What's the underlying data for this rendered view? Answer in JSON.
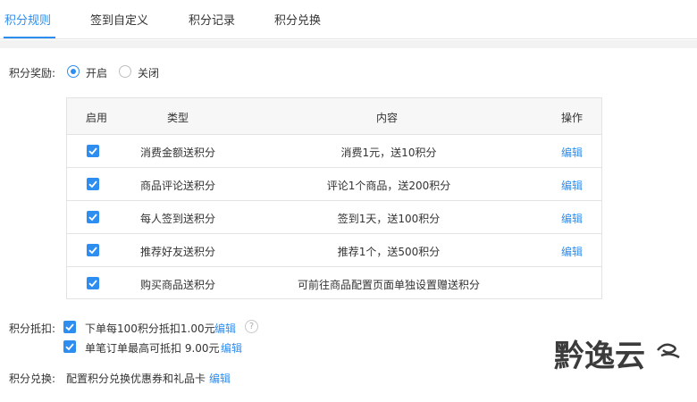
{
  "tabs": [
    {
      "label": "积分规则",
      "active": true
    },
    {
      "label": "签到自定义",
      "active": false
    },
    {
      "label": "积分记录",
      "active": false
    },
    {
      "label": "积分兑换",
      "active": false
    }
  ],
  "reward": {
    "label": "积分奖励:",
    "on_label": "开启",
    "off_label": "关闭",
    "selected": "开启"
  },
  "table": {
    "headers": {
      "enabled": "启用",
      "type": "类型",
      "content": "内容",
      "action": "操作"
    },
    "rows": [
      {
        "enabled": true,
        "type": "消费金额送积分",
        "content": "消费1元，送10积分",
        "action": "编辑"
      },
      {
        "enabled": true,
        "type": "商品评论送积分",
        "content": "评论1个商品，送200积分",
        "action": "编辑"
      },
      {
        "enabled": true,
        "type": "每人签到送积分",
        "content": "签到1天，送100积分",
        "action": "编辑"
      },
      {
        "enabled": true,
        "type": "推荐好友送积分",
        "content": "推荐1个，送500积分",
        "action": "编辑"
      },
      {
        "enabled": true,
        "type": "购买商品送积分",
        "content": "可前往商品配置页面单独设置赠送积分",
        "action": ""
      }
    ]
  },
  "deduction": {
    "label": "积分抵扣:",
    "rule1": {
      "checked": true,
      "text": "下单每100积分抵扣1.00元",
      "edit": "编辑",
      "help": "?"
    },
    "rule2": {
      "checked": true,
      "text": "单笔订单最高可抵扣 9.00元",
      "edit": "编辑"
    }
  },
  "exchange": {
    "label": "积分兑换:",
    "text": "配置积分兑换优惠券和礼品卡",
    "edit": "编辑"
  },
  "watermark": {
    "text": "黔逸云"
  },
  "colors": {
    "accent": "#2e8ef0",
    "border": "#e3e3e3",
    "header_bg": "#f7f7f7"
  }
}
